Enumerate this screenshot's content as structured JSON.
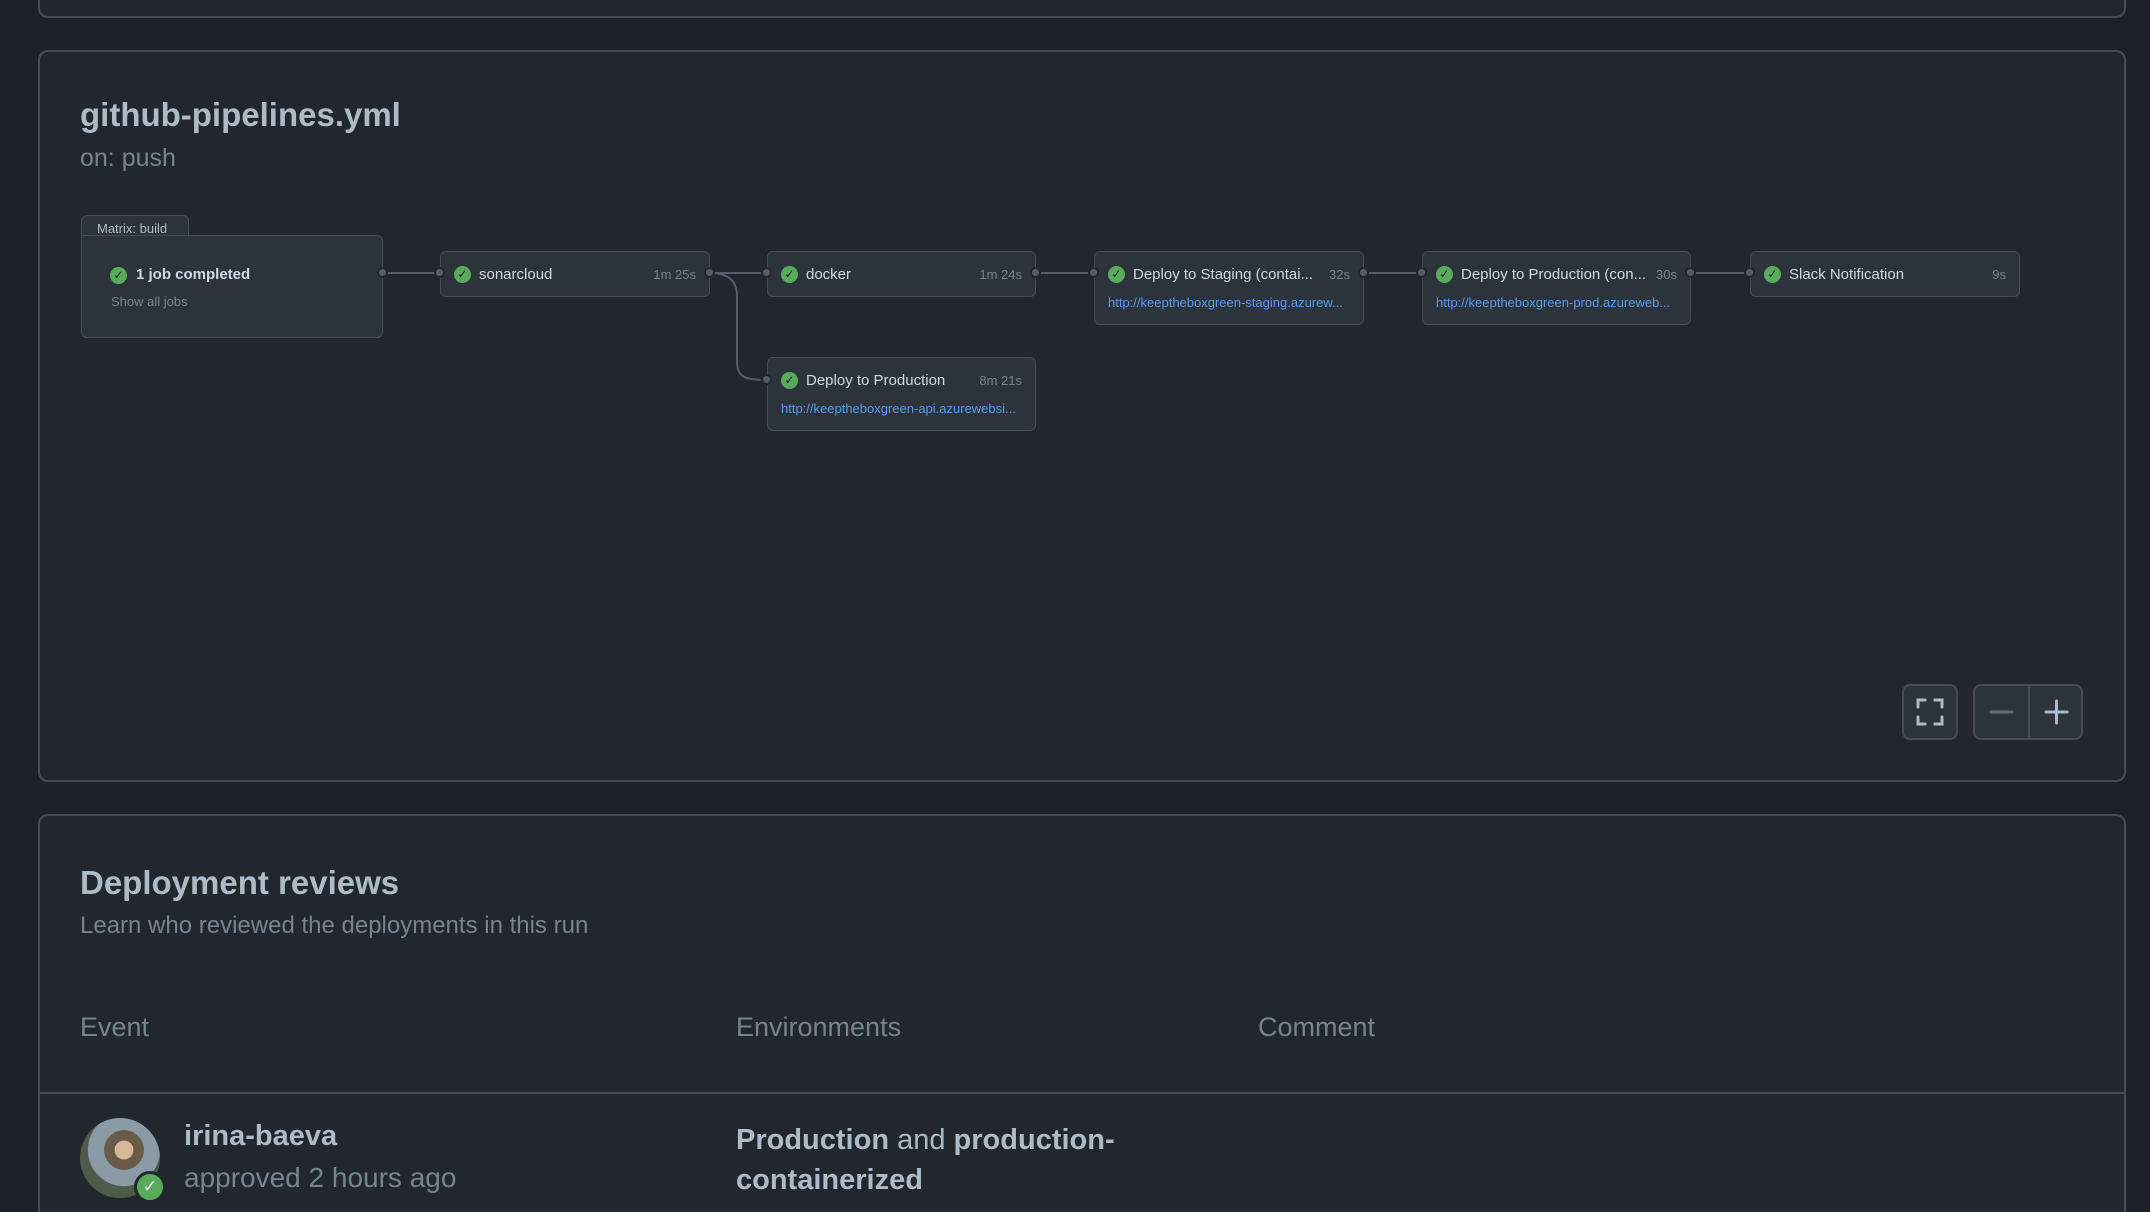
{
  "workflow": {
    "title": "github-pipelines.yml",
    "trigger": "on: push"
  },
  "graph": {
    "matrix": {
      "label": "Matrix: build",
      "status": "1 job completed",
      "show_all": "Show all jobs"
    },
    "jobs": [
      {
        "id": "sonarcloud",
        "name": "sonarcloud",
        "duration": "1m 25s",
        "link": ""
      },
      {
        "id": "docker",
        "name": "docker",
        "duration": "1m 24s",
        "link": ""
      },
      {
        "id": "deploy-staging",
        "name": "Deploy to Staging (contai...",
        "duration": "32s",
        "link": "http://keeptheboxgreen-staging.azurew..."
      },
      {
        "id": "deploy-prod-container",
        "name": "Deploy to Production (con...",
        "duration": "30s",
        "link": "http://keeptheboxgreen-prod.azureweb..."
      },
      {
        "id": "slack",
        "name": "Slack Notification",
        "duration": "9s",
        "link": ""
      },
      {
        "id": "deploy-prod",
        "name": "Deploy to Production",
        "duration": "8m 21s",
        "link": "http://keeptheboxgreen-api.azurewebsi..."
      }
    ],
    "status_color": "#57ab5a",
    "link_color": "#539bf5"
  },
  "controls": {
    "fullscreen_icon": "fullscreen-icon",
    "zoom_out_icon": "minus-icon",
    "zoom_in_icon": "plus-icon"
  },
  "reviews": {
    "title": "Deployment reviews",
    "subtitle": "Learn who reviewed the deployments in this run",
    "columns": [
      "Event",
      "Environments",
      "Comment"
    ],
    "rows": [
      {
        "user": "irina-baeva",
        "action": "approved 2 hours ago",
        "env_1": "Production",
        "env_joiner": " and ",
        "env_2": "production-containerized",
        "comment": ""
      }
    ]
  }
}
